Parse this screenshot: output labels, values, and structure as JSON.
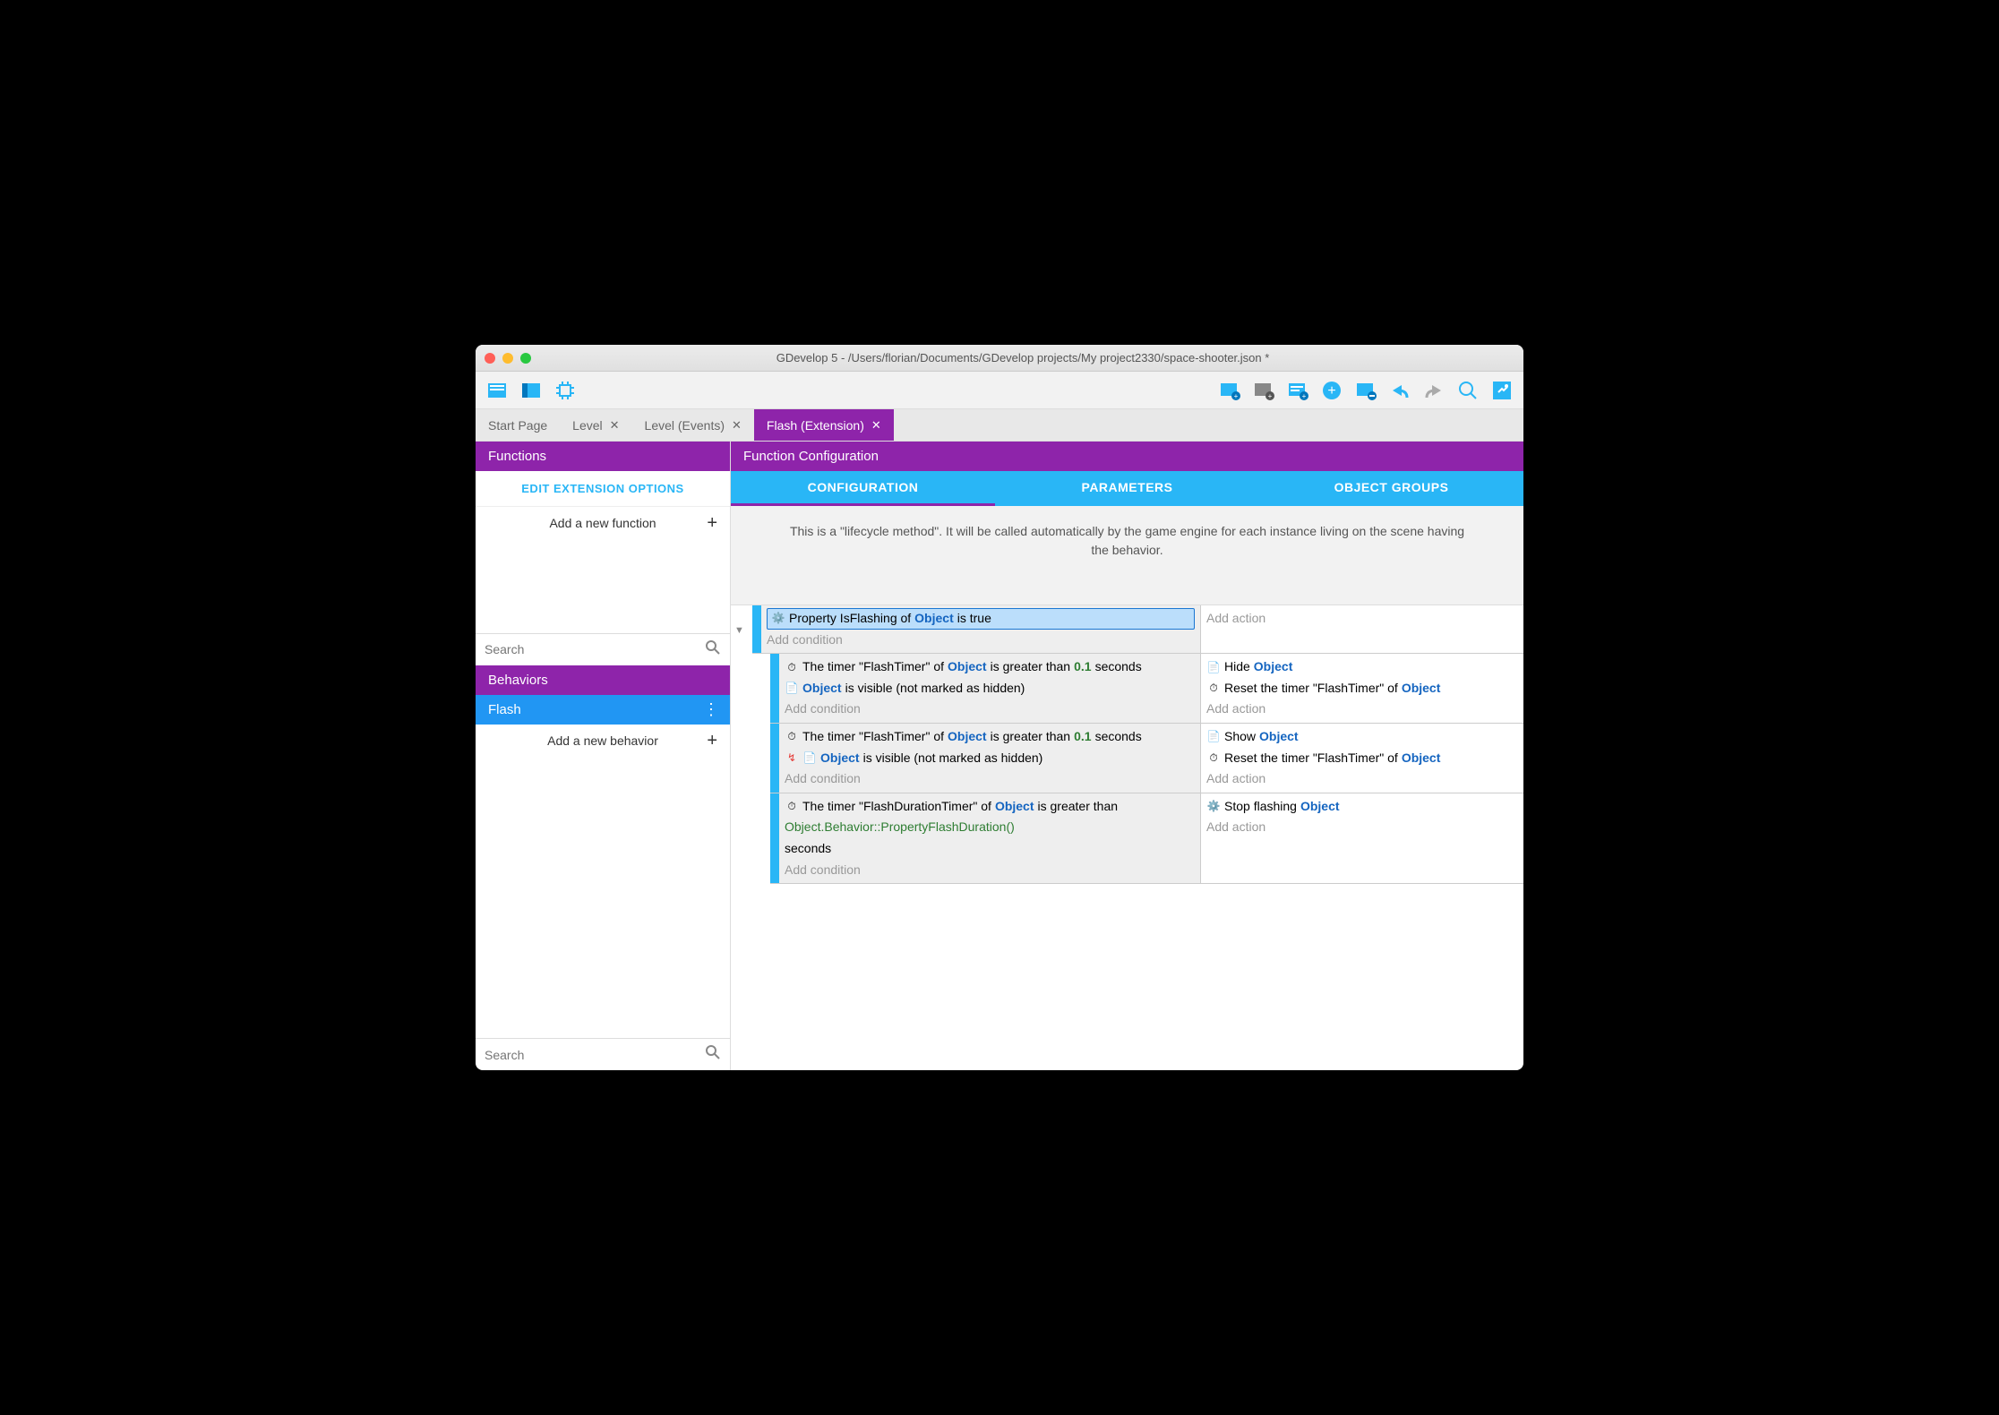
{
  "window": {
    "title": "GDevelop 5 - /Users/florian/Documents/GDevelop projects/My project2330/space-shooter.json *"
  },
  "tabs": [
    {
      "label": "Start Page",
      "closable": false,
      "active": false
    },
    {
      "label": "Level",
      "closable": true,
      "active": false
    },
    {
      "label": "Level (Events)",
      "closable": true,
      "active": false
    },
    {
      "label": "Flash (Extension)",
      "closable": true,
      "active": true
    }
  ],
  "sidebar": {
    "functions_header": "Functions",
    "edit_options": "EDIT EXTENSION OPTIONS",
    "add_function": "Add a new function",
    "search_placeholder": "Search",
    "behaviors_header": "Behaviors",
    "behavior_item": "Flash",
    "add_behavior": "Add a new behavior",
    "search2_placeholder": "Search"
  },
  "config": {
    "header": "Function Configuration",
    "tab_config": "CONFIGURATION",
    "tab_params": "PARAMETERS",
    "tab_groups": "OBJECT GROUPS",
    "description": "This is a \"lifecycle method\". It will be called automatically by the game engine for each instance living on the scene having the behavior."
  },
  "events": {
    "add_condition": "Add condition",
    "add_action": "Add action",
    "obj": "Object",
    "e0_cond1_a": "Property IsFlashing of",
    "e0_cond1_b": "is true",
    "e1_cond1_a": "The timer \"FlashTimer\" of",
    "e1_cond1_b": "is greater than",
    "e1_cond1_val": "0.1",
    "e1_cond1_c": "seconds",
    "e1_cond2_b": "is visible (not marked as hidden)",
    "e1_act1_a": "Hide",
    "e1_act2_a": "Reset the timer \"FlashTimer\" of",
    "e2_cond1_a": "The timer \"FlashTimer\" of",
    "e2_cond1_b": "is greater than",
    "e2_cond1_val": "0.1",
    "e2_cond1_c": "seconds",
    "e2_cond2_b": "is visible (not marked as hidden)",
    "e2_act1_a": "Show",
    "e2_act2_a": "Reset the timer \"FlashTimer\" of",
    "e3_cond1_a": "The timer \"FlashDurationTimer\" of",
    "e3_cond1_b": "is greater than",
    "e3_cond1_expr": "Object.Behavior::PropertyFlashDuration()",
    "e3_cond1_c": "seconds",
    "e3_act1_a": "Stop flashing"
  }
}
